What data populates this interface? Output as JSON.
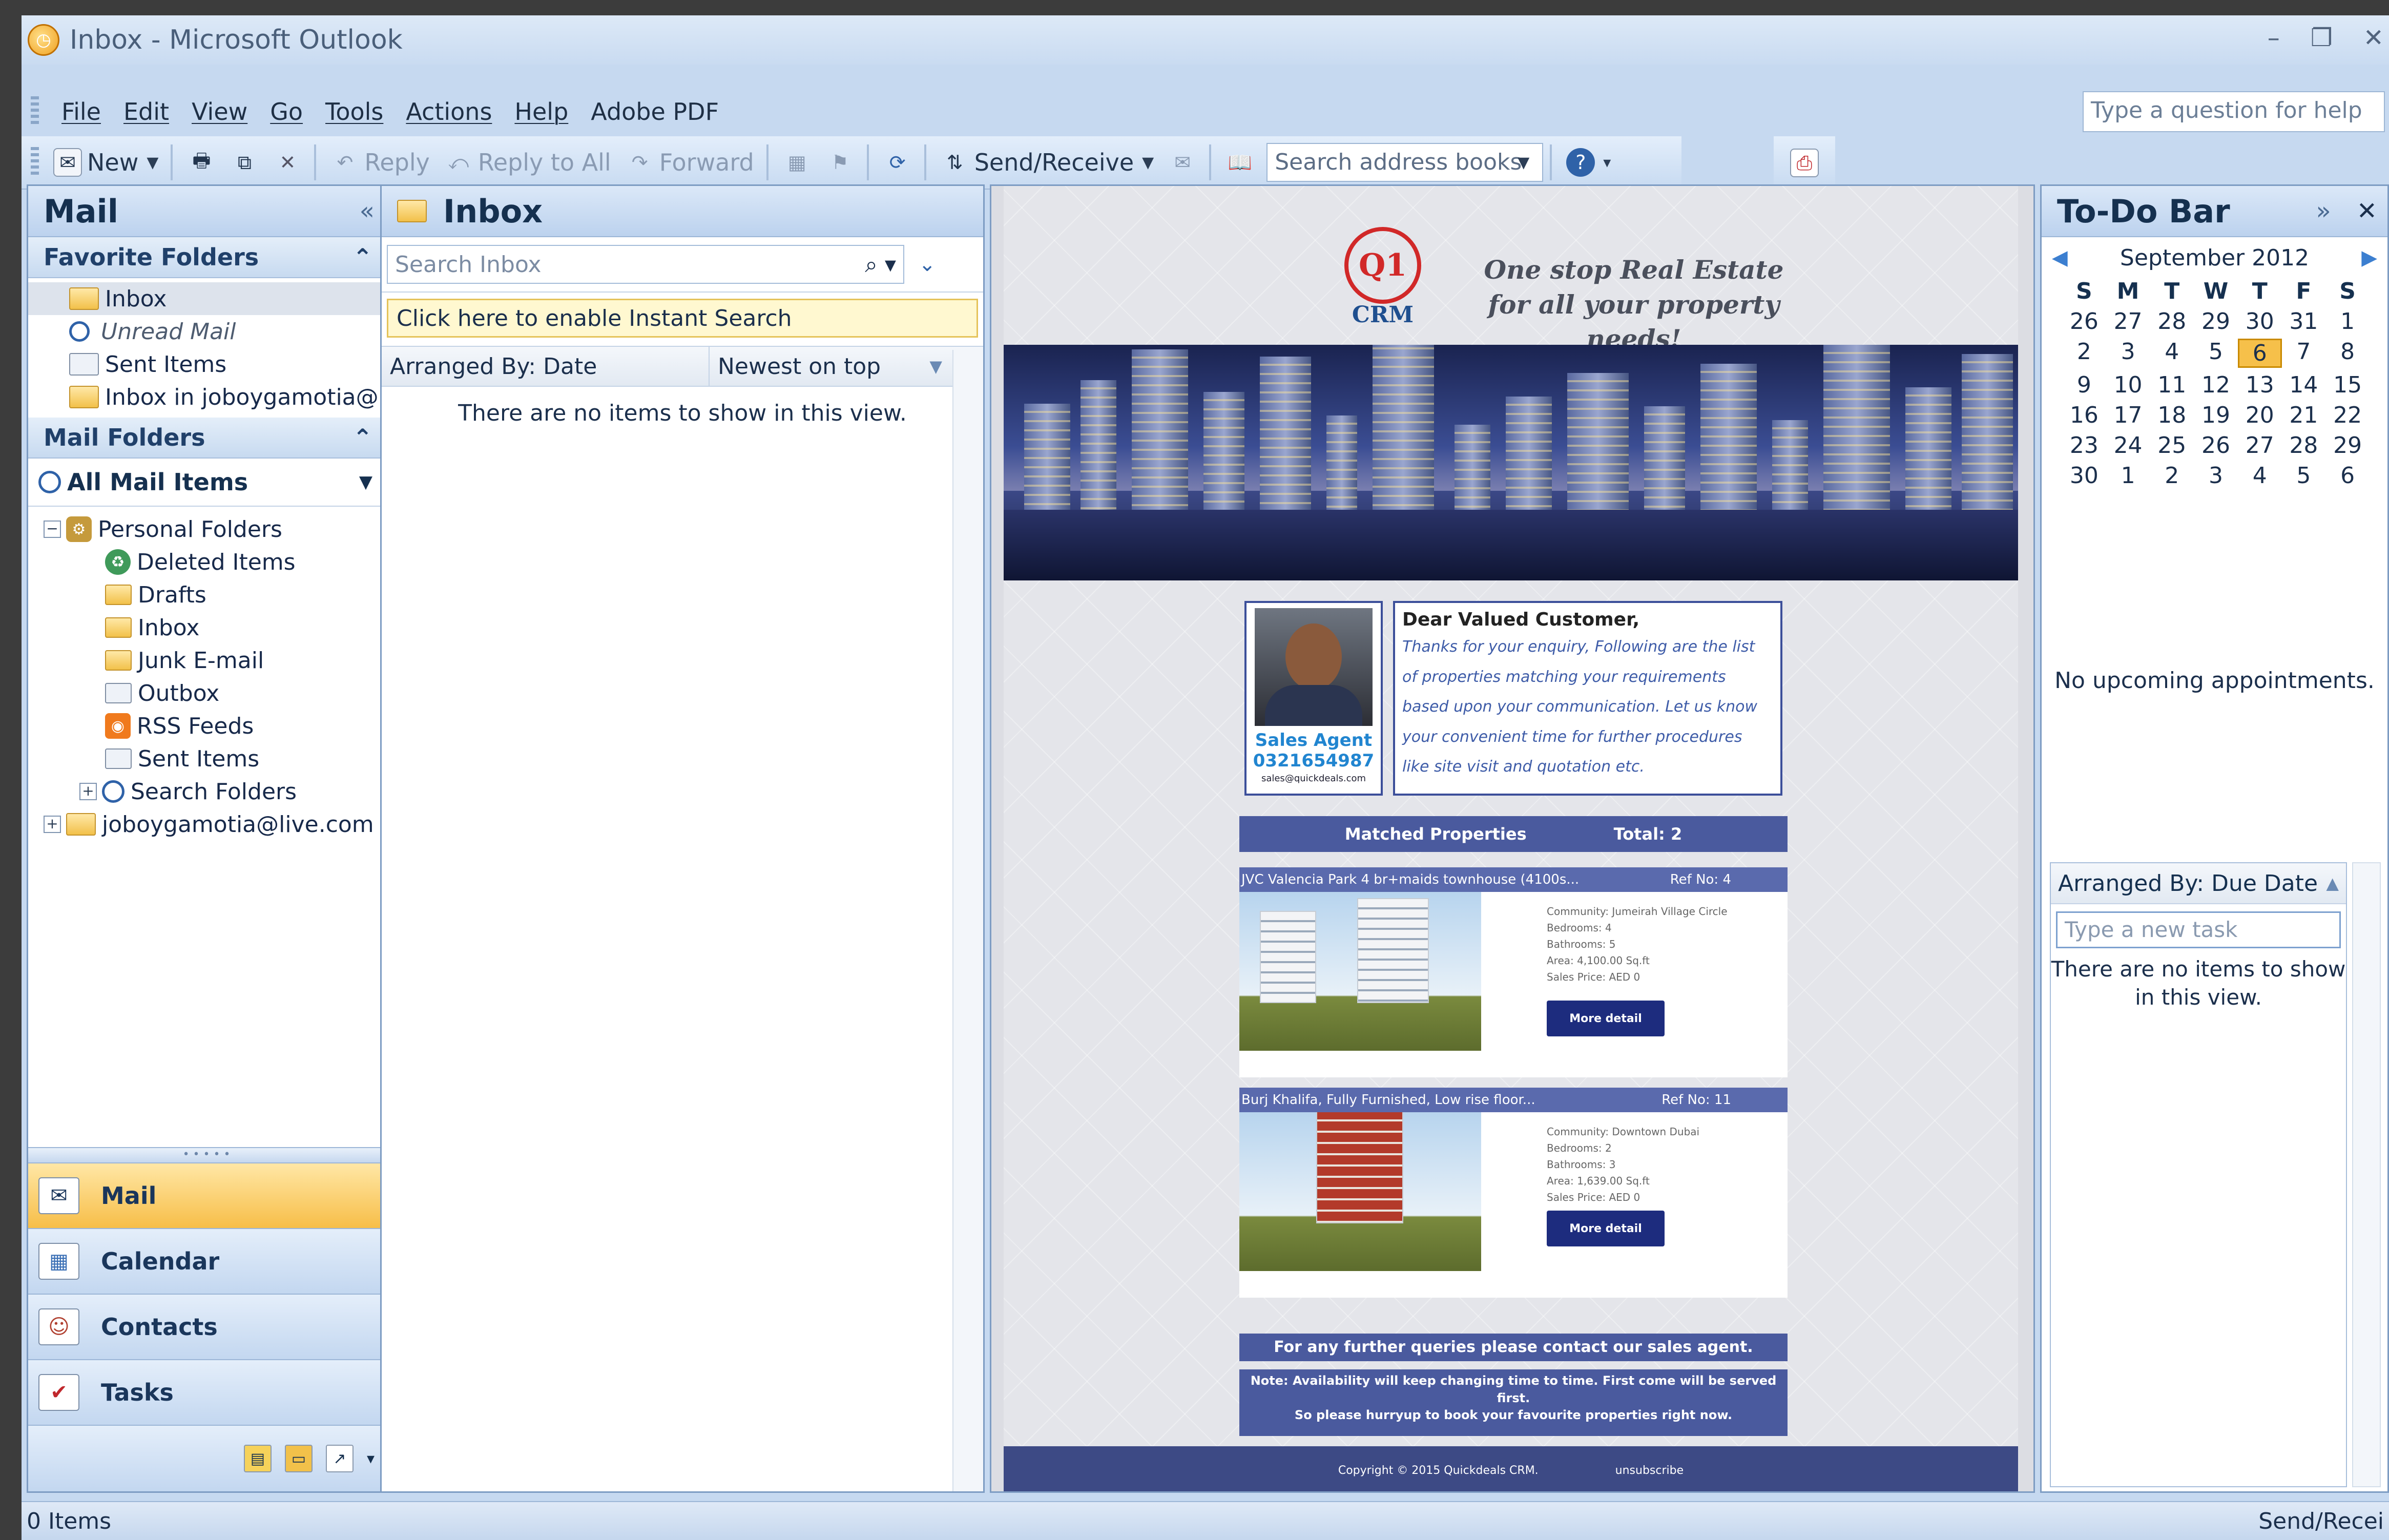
{
  "window": {
    "title": "Inbox - Microsoft Outlook",
    "controls": [
      "–",
      "❐",
      "✕"
    ]
  },
  "menu": {
    "items": [
      "File",
      "Edit",
      "View",
      "Go",
      "Tools",
      "Actions",
      "Help",
      "Adobe PDF"
    ],
    "help_placeholder": "Type a question for help"
  },
  "toolbar": {
    "new": "New",
    "reply": "Reply",
    "reply_all": "Reply to All",
    "forward": "Forward",
    "send_receive": "Send/Receive",
    "address_placeholder": "Search address books"
  },
  "nav": {
    "title": "Mail",
    "favorites_header": "Favorite Folders",
    "favorites": [
      "Inbox",
      "Unread Mail",
      "Sent Items",
      "Inbox in joboygamotia@"
    ],
    "mail_folders_header": "Mail Folders",
    "all_mail": "All Mail Items",
    "personal_folders": "Personal Folders",
    "folders": [
      "Deleted Items",
      "Drafts",
      "Inbox",
      "Junk E-mail",
      "Outbox",
      "RSS Feeds",
      "Sent Items",
      "Search Folders"
    ],
    "account": "joboygamotia@live.com",
    "buttons": [
      "Mail",
      "Calendar",
      "Contacts",
      "Tasks"
    ]
  },
  "list": {
    "title": "Inbox",
    "search_placeholder": "Search Inbox",
    "instant_search": "Click here to enable Instant Search",
    "arranged_by": "Arranged By: Date",
    "sort_order": "Newest on top",
    "empty": "There are no items to show in this view."
  },
  "email": {
    "logo_badge": "Q1",
    "logo_text": "CRM",
    "tagline": "One stop Real Estate for all your property needs!",
    "agent_name": "Sales Agent",
    "agent_phone": "0321654987",
    "agent_email": "sales@quickdeals.com",
    "greeting_title": "Dear Valued Customer,",
    "greeting_body": "Thanks for your enquiry, Following are the list of properties matching your requirements based upon your communication. Let us know your convenient time for further procedures like site visit and quotation etc.",
    "matched_label": "Matched Properties",
    "total_label": "Total: 2",
    "properties": [
      {
        "title": "JVC Valencia Park 4 br+maids townhouse (4100s...",
        "ref": "Ref No: 4",
        "details": [
          "Community: Jumeirah Village Circle",
          "Bedrooms: 4",
          "Bathrooms: 5",
          "Area: 4,100.00 Sq.ft",
          "Sales Price: AED 0"
        ],
        "button": "More detail"
      },
      {
        "title": "Burj Khalifa, Fully Furnished, Low rise floor...",
        "ref": "Ref No: 11",
        "details": [
          "Community: Downtown Dubai",
          "Bedrooms: 2",
          "Bathrooms: 3",
          "Area: 1,639.00 Sq.ft",
          "Sales Price: AED 0"
        ],
        "button": "More detail"
      }
    ],
    "queries": "For any further queries please contact our sales agent.",
    "note_line1": "Note: Availability will keep changing time to time. First come will be served first.",
    "note_line2": "So please hurryup to book your favourite properties right now.",
    "copyright": "Copyright © 2015 Quickdeals CRM.",
    "unsubscribe": "unsubscribe"
  },
  "todo": {
    "title": "To-Do Bar",
    "month": "September 2012",
    "dow": [
      "S",
      "M",
      "T",
      "W",
      "T",
      "F",
      "S"
    ],
    "weeks": [
      [
        "26",
        "27",
        "28",
        "29",
        "30",
        "31",
        "1"
      ],
      [
        "2",
        "3",
        "4",
        "5",
        "6",
        "7",
        "8"
      ],
      [
        "9",
        "10",
        "11",
        "12",
        "13",
        "14",
        "15"
      ],
      [
        "16",
        "17",
        "18",
        "19",
        "20",
        "21",
        "22"
      ],
      [
        "23",
        "24",
        "25",
        "26",
        "27",
        "28",
        "29"
      ],
      [
        "30",
        "1",
        "2",
        "3",
        "4",
        "5",
        "6"
      ]
    ],
    "today": "6",
    "no_appointments": "No upcoming appointments.",
    "task_arranged": "Arranged By: Due Date",
    "task_placeholder": "Type a new task",
    "task_empty": "There are no items to show in this view."
  },
  "status": {
    "items": "0 Items",
    "right": "Send/Recei"
  }
}
